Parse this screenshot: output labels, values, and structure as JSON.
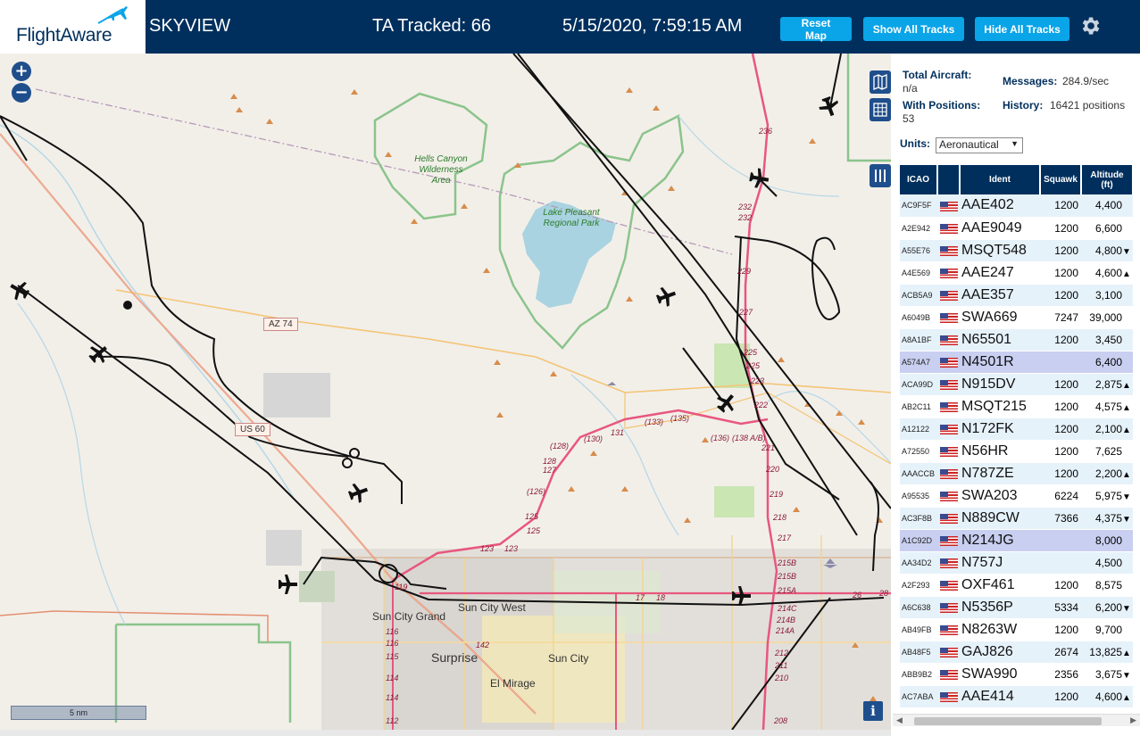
{
  "header": {
    "logo_text": "FlightAware",
    "site_name": "SKYVIEW",
    "tracked": "TA Tracked: 66",
    "datetime": "5/15/2020, 7:59:15 AM",
    "buttons": {
      "reset": "Reset Map",
      "show_all": "Show All Tracks",
      "hide_all": "Hide All Tracks"
    },
    "icons": {
      "settings": "gear-icon",
      "logo": "airplane-logo-icon"
    }
  },
  "map": {
    "zoom_in": "+",
    "zoom_out": "−",
    "scale": "5 nm",
    "info": "i",
    "labels": {
      "az74": "AZ 74",
      "us60": "US 60",
      "hells_canyon": "Hells Canyon Wilderness Area",
      "lake_pleasant": "Lake Pleasant Regional Park",
      "sun_city_grand": "Sun City Grand",
      "sun_city_west": "Sun City West",
      "surprise": "Surprise",
      "sun_city": "Sun City",
      "el_mirage": "El Mirage"
    },
    "exits": [
      "236",
      "232",
      "232",
      "229",
      "227",
      "225",
      "225",
      "223",
      "222",
      "221",
      "220",
      "219",
      "218",
      "217",
      "215B",
      "215B",
      "215A",
      "214C",
      "214B",
      "214A",
      "212",
      "211",
      "210",
      "208",
      "(138 A/B)",
      "(136)",
      "(135)",
      "(133)",
      "131",
      "(130)",
      "(128)",
      "128",
      "127",
      "(126)",
      "125",
      "125",
      "123",
      "123",
      "119",
      "116",
      "116",
      "115",
      "114",
      "114",
      "112",
      "142",
      "17",
      "18",
      "26",
      "28"
    ]
  },
  "sidebar": {
    "total_aircraft_label": "Total Aircraft:",
    "total_aircraft_value": "n/a",
    "messages_label": "Messages:",
    "messages_value": "284.9/sec",
    "with_positions_label": "With Positions:",
    "with_positions_value": "53",
    "history_label": "History:",
    "history_value": "16421 positions",
    "units_label": "Units:",
    "units_value": "Aeronautical",
    "columns": [
      "ICAO",
      "",
      "Ident",
      "Squawk",
      "Altitude (ft)"
    ],
    "rows": [
      {
        "icao": "AC9F5F",
        "ident": "AAE402",
        "squawk": "1200",
        "alt": "4,400",
        "trend": ""
      },
      {
        "icao": "A2E942",
        "ident": "AAE9049",
        "squawk": "1200",
        "alt": "6,600",
        "trend": ""
      },
      {
        "icao": "A55E76",
        "ident": "MSQT548",
        "squawk": "1200",
        "alt": "4,800",
        "trend": "▼"
      },
      {
        "icao": "A4E569",
        "ident": "AAE247",
        "squawk": "1200",
        "alt": "4,600",
        "trend": "▲"
      },
      {
        "icao": "ACB5A9",
        "ident": "AAE357",
        "squawk": "1200",
        "alt": "3,100",
        "trend": ""
      },
      {
        "icao": "A6049B",
        "ident": "SWA669",
        "squawk": "7247",
        "alt": "39,000",
        "trend": ""
      },
      {
        "icao": "A8A1BF",
        "ident": "N65501",
        "squawk": "1200",
        "alt": "3,450",
        "trend": ""
      },
      {
        "icao": "A574A7",
        "ident": "N4501R",
        "squawk": "",
        "alt": "6,400",
        "trend": "",
        "selected": true
      },
      {
        "icao": "ACA99D",
        "ident": "N915DV",
        "squawk": "1200",
        "alt": "2,875",
        "trend": "▲"
      },
      {
        "icao": "AB2C11",
        "ident": "MSQT215",
        "squawk": "1200",
        "alt": "4,575",
        "trend": "▲"
      },
      {
        "icao": "A12122",
        "ident": "N172FK",
        "squawk": "1200",
        "alt": "2,100",
        "trend": "▲"
      },
      {
        "icao": "A72550",
        "ident": "N56HR",
        "squawk": "1200",
        "alt": "7,625",
        "trend": ""
      },
      {
        "icao": "AAACCB",
        "ident": "N787ZE",
        "squawk": "1200",
        "alt": "2,200",
        "trend": "▲"
      },
      {
        "icao": "A95535",
        "ident": "SWA203",
        "squawk": "6224",
        "alt": "5,975",
        "trend": "▼"
      },
      {
        "icao": "AC3F8B",
        "ident": "N889CW",
        "squawk": "7366",
        "alt": "4,375",
        "trend": "▼"
      },
      {
        "icao": "A1C92D",
        "ident": "N214JG",
        "squawk": "",
        "alt": "8,000",
        "trend": "",
        "selected": true
      },
      {
        "icao": "AA34D2",
        "ident": "N757J",
        "squawk": "",
        "alt": "4,500",
        "trend": ""
      },
      {
        "icao": "A2F293",
        "ident": "OXF461",
        "squawk": "1200",
        "alt": "8,575",
        "trend": ""
      },
      {
        "icao": "A6C638",
        "ident": "N5356P",
        "squawk": "5334",
        "alt": "6,200",
        "trend": "▼"
      },
      {
        "icao": "AB49FB",
        "ident": "N8263W",
        "squawk": "1200",
        "alt": "9,700",
        "trend": ""
      },
      {
        "icao": "AB48F5",
        "ident": "GAJ826",
        "squawk": "2674",
        "alt": "13,825",
        "trend": "▲"
      },
      {
        "icao": "ABB9B2",
        "ident": "SWA990",
        "squawk": "2356",
        "alt": "3,675",
        "trend": "▼"
      },
      {
        "icao": "AC7ABA",
        "ident": "AAE414",
        "squawk": "1200",
        "alt": "4,600",
        "trend": "▲"
      }
    ]
  },
  "colors": {
    "header_bg": "#002f5d",
    "button": "#0aa4e8",
    "row_alt": "#e6f2fa",
    "row_selected": "#c8cff0",
    "track": "#111111",
    "highway": "#e8577e"
  }
}
